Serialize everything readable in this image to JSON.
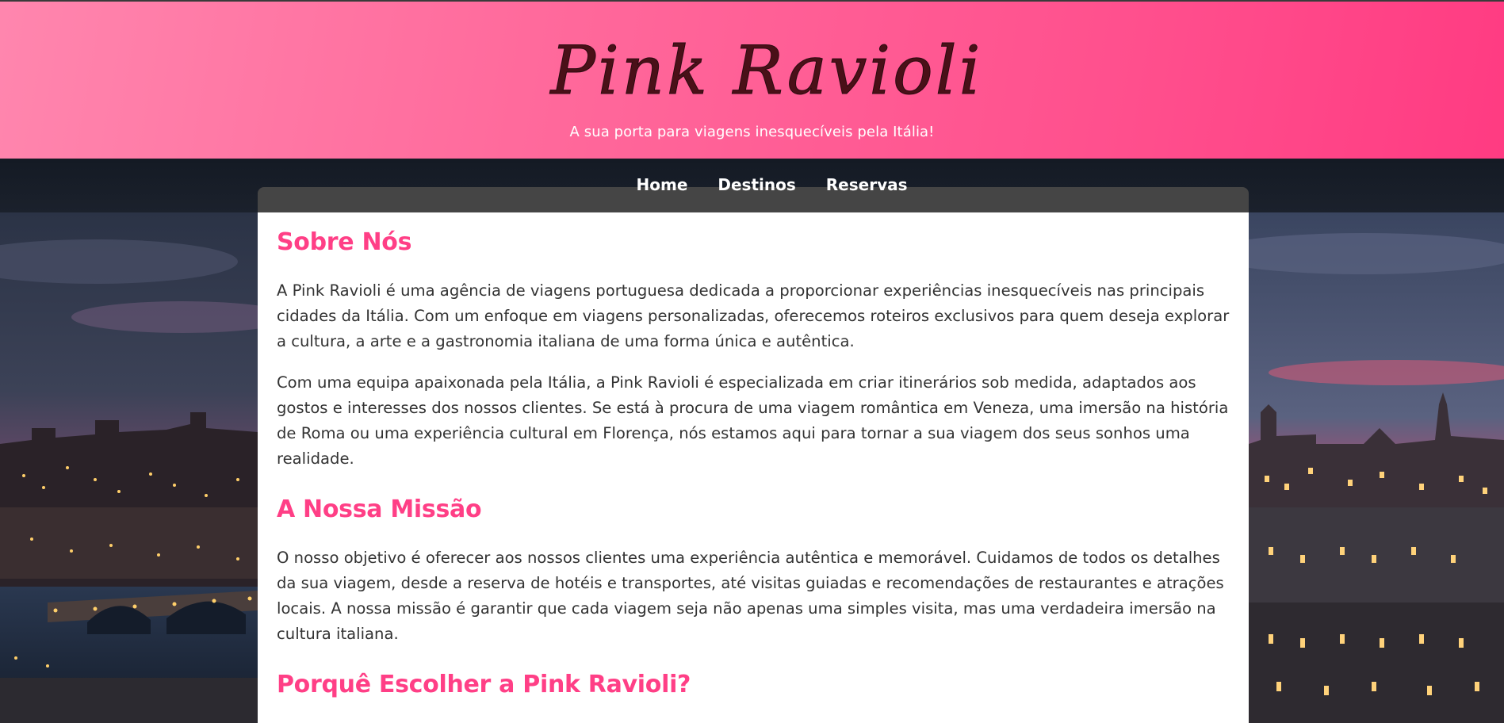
{
  "header": {
    "logo_text": "Pink Ravioli",
    "tagline": "A sua porta para viagens inesquecíveis pela Itália!"
  },
  "nav": {
    "items": [
      {
        "label": "Home"
      },
      {
        "label": "Destinos"
      },
      {
        "label": "Reservas"
      }
    ]
  },
  "main": {
    "sections": [
      {
        "title": "Sobre Nós",
        "paragraphs": [
          "A Pink Ravioli é uma agência de viagens portuguesa dedicada a proporcionar experiências inesquecíveis nas principais cidades da Itália. Com um enfoque em viagens personalizadas, oferecemos roteiros exclusivos para quem deseja explorar a cultura, a arte e a gastronomia italiana de uma forma única e autêntica.",
          "Com uma equipa apaixonada pela Itália, a Pink Ravioli é especializada em criar itinerários sob medida, adaptados aos gostos e interesses dos nossos clientes. Se está à procura de uma viagem romântica em Veneza, uma imersão na história de Roma ou uma experiência cultural em Florença, nós estamos aqui para tornar a sua viagem dos seus sonhos uma realidade."
        ]
      },
      {
        "title": "A Nossa Missão",
        "paragraphs": [
          "O nosso objetivo é oferecer aos nossos clientes uma experiência autêntica e memorável. Cuidamos de todos os detalhes da sua viagem, desde a reserva de hotéis e transportes, até visitas guiadas e recomendações de restaurantes e atrações locais. A nossa missão é garantir que cada viagem seja não apenas uma simples visita, mas uma verdadeira imersão na cultura italiana."
        ]
      },
      {
        "title": "Porquê Escolher a Pink Ravioli?"
      }
    ]
  },
  "colors": {
    "brand_pink": "#ff3f86",
    "header_gradient_start": "#ff86ae",
    "header_gradient_end": "#ff3b82",
    "nav_background": "#161c26",
    "logo_color": "#4a1018"
  },
  "background": {
    "icon": "rome-sunset-cityscape-image"
  }
}
